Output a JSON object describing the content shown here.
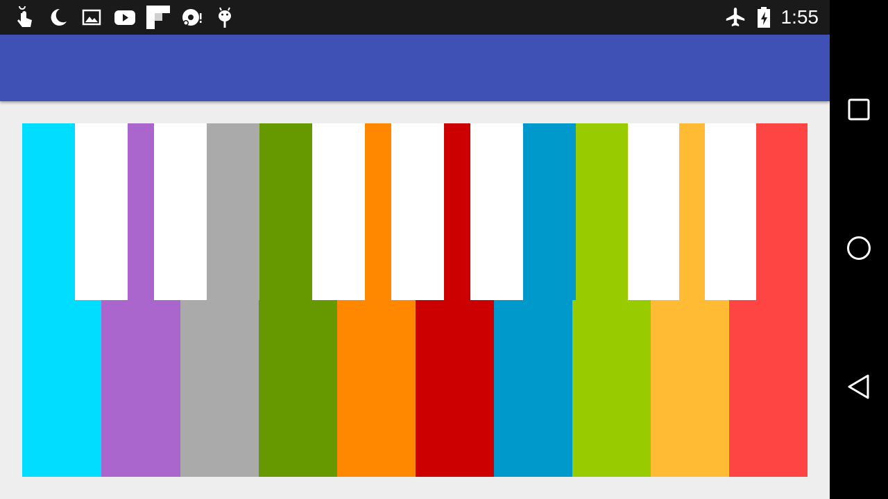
{
  "status_bar": {
    "left_icons": [
      "touch-app-icon",
      "moon-icon",
      "image-icon",
      "youtube-icon",
      "flipboard-icon",
      "disc-icon",
      "android-debug-icon"
    ],
    "right_icons": [
      "airplane-mode-icon",
      "battery-charging-icon"
    ],
    "time": "1:55",
    "background_color": "#1a1a1a"
  },
  "app_bar": {
    "title": "",
    "color": "#3f51b5"
  },
  "keyboard": {
    "bars": [
      {
        "name": "bar-1",
        "color": "#00ddff"
      },
      {
        "name": "bar-2",
        "color": "#aa66cc"
      },
      {
        "name": "bar-3",
        "color": "#aaaaaa"
      },
      {
        "name": "bar-4",
        "color": "#669900"
      },
      {
        "name": "bar-5",
        "color": "#ff8800"
      },
      {
        "name": "bar-6",
        "color": "#cc0000"
      },
      {
        "name": "bar-7",
        "color": "#0099cc"
      },
      {
        "name": "bar-8",
        "color": "#99cc00"
      },
      {
        "name": "bar-9",
        "color": "#ffbb33"
      },
      {
        "name": "bar-10",
        "color": "#ff4444"
      }
    ],
    "top_keys": [
      {
        "color": "#00ddff"
      },
      {
        "color": "#ffffff"
      },
      {
        "color": "#aa66cc"
      },
      {
        "color": "#ffffff"
      },
      {
        "color": "#aaaaaa"
      },
      {
        "color": "#669900"
      },
      {
        "color": "#ffffff"
      },
      {
        "color": "#ff8800"
      },
      {
        "color": "#ffffff"
      },
      {
        "color": "#cc0000"
      },
      {
        "color": "#ffffff"
      },
      {
        "color": "#0099cc"
      },
      {
        "color": "#99cc00"
      },
      {
        "color": "#ffffff"
      },
      {
        "color": "#ffbb33"
      },
      {
        "color": "#ffffff"
      },
      {
        "color": "#ff4444"
      }
    ]
  },
  "nav_bar": {
    "buttons": [
      "recents-square-icon",
      "home-circle-icon",
      "back-triangle-icon"
    ]
  },
  "colors": {
    "background": "#eeeeee",
    "nav_background": "#000000",
    "icon": "#ffffff"
  }
}
